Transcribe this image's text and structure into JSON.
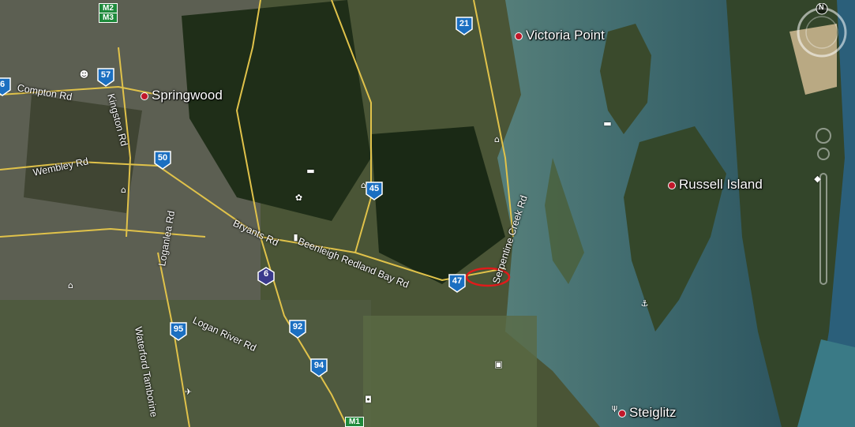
{
  "places": {
    "victoria_point": "Victoria Point",
    "springwood": "Springwood",
    "russell_island": "Russell Island",
    "steiglitz": "Steiglitz"
  },
  "roads": {
    "compton": "Compton Rd",
    "kingston": "Kingston Rd",
    "wembley": "Wembley Rd",
    "loganlea": "Loganlea Rd",
    "bryants": "Bryants Rd",
    "beenleigh": "Beenleigh Redland Bay Rd",
    "serpentine": "Serpentine Creek Rd",
    "logan_river": "Logan River Rd",
    "waterford": "Waterford Tamborine"
  },
  "route_shields": {
    "r21": "21",
    "r57": "57",
    "r50": "50",
    "r45": "45",
    "r47": "47",
    "r6": "6",
    "r92": "92",
    "r94": "94",
    "r95": "95",
    "r6_left": "6"
  },
  "motorway_shields": {
    "m2": "M2",
    "m3": "M3",
    "m1": "M1"
  },
  "compass": {
    "north": "N"
  },
  "colors": {
    "water": "#3f6f73",
    "land": "#2f3d24",
    "road": "#e0c24a",
    "shield": "#1b6fc1",
    "marker": "#c0182a"
  }
}
